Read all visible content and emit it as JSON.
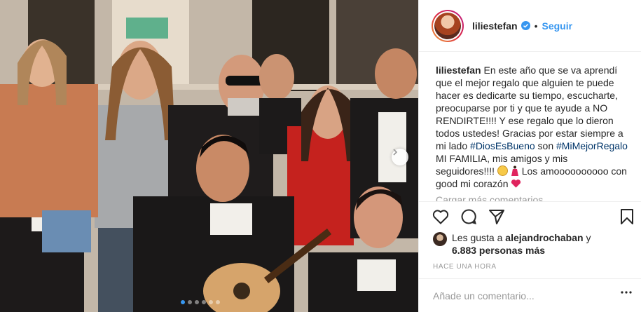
{
  "post": {
    "username": "liliestefan",
    "separator": "•",
    "follow_label": "Seguir",
    "caption": {
      "username": "liliestefan",
      "text_1": "En este año que se va aprendí que el mejor regalo que alguien te puede hacer es dedicarte su tiempo, escucharte, preocuparse por ti y que te ayude a NO RENDIRTE!!!! Y ese regalo que lo dieron todos ustedes! Gracias por estar siempre a mi lado",
      "hashtag_1": "#DiosEsBueno",
      "text_2": "son",
      "hashtag_2": "#MiMejorRegalo",
      "text_3": "MI FAMILIA, mis amigos y mis seguidores!!!!",
      "text_4": "Los amoooooooooo con good mi corazón"
    },
    "load_more": "Cargar más comentarios",
    "likes": {
      "prefix": "Les gusta a",
      "user": "alejandrochaban",
      "joiner": "y",
      "count": "6.883 personas más"
    },
    "time": "HACE UNA HORA",
    "comment_placeholder": "Añade un comentario...",
    "carousel": {
      "total": 6,
      "active": 1
    }
  },
  "colors": {
    "accent": "#3897f0",
    "hashtag": "#003569",
    "muted": "#999999",
    "text": "#262626",
    "border": "#efefef"
  },
  "icons": [
    "verified-icon",
    "heart-icon",
    "comment-icon",
    "share-icon",
    "bookmark-icon",
    "more-icon",
    "chevron-right-icon"
  ]
}
